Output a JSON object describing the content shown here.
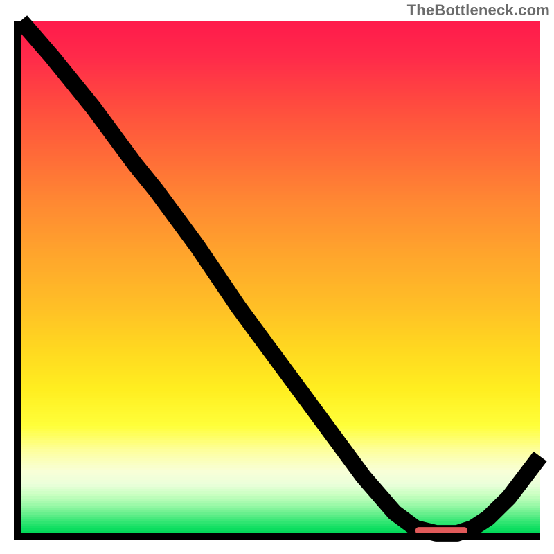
{
  "watermark": "TheBottleneck.com",
  "colors": {
    "axis": "#000000",
    "marker": "#e15a5a",
    "curve": "#000000"
  },
  "gradient_stops": [
    {
      "pct": 0.0,
      "color": "#ff1a4b"
    },
    {
      "pct": 0.07,
      "color": "#ff2a4a"
    },
    {
      "pct": 0.16,
      "color": "#ff4a3f"
    },
    {
      "pct": 0.26,
      "color": "#ff6a38"
    },
    {
      "pct": 0.36,
      "color": "#ff8a32"
    },
    {
      "pct": 0.46,
      "color": "#ffa62c"
    },
    {
      "pct": 0.56,
      "color": "#ffc026"
    },
    {
      "pct": 0.64,
      "color": "#ffd820"
    },
    {
      "pct": 0.72,
      "color": "#ffee20"
    },
    {
      "pct": 0.79,
      "color": "#ffff3a"
    },
    {
      "pct": 0.84,
      "color": "#fdffa0"
    },
    {
      "pct": 0.88,
      "color": "#f8ffd8"
    },
    {
      "pct": 0.905,
      "color": "#eaffda"
    },
    {
      "pct": 0.925,
      "color": "#c8ffc0"
    },
    {
      "pct": 0.945,
      "color": "#99f8a7"
    },
    {
      "pct": 0.962,
      "color": "#66ef8c"
    },
    {
      "pct": 0.978,
      "color": "#33e673"
    },
    {
      "pct": 0.99,
      "color": "#11df62"
    },
    {
      "pct": 1.0,
      "color": "#00d858"
    }
  ],
  "chart_data": {
    "type": "line",
    "title": "",
    "xlabel": "",
    "ylabel": "",
    "xlim": [
      0,
      100
    ],
    "ylim": [
      0,
      100
    ],
    "grid": false,
    "legend": false,
    "series": [
      {
        "name": "curve",
        "x": [
          0,
          6,
          14,
          22,
          26,
          34,
          42,
          50,
          58,
          66,
          72,
          76,
          80,
          84,
          87,
          90,
          94,
          100
        ],
        "y": [
          100,
          93,
          83,
          72,
          67,
          56,
          44,
          33,
          22,
          11,
          4,
          1,
          0,
          0,
          1,
          3,
          7,
          15
        ]
      }
    ],
    "highlight_segment": {
      "x_start": 76,
      "x_end": 86,
      "y": 0.5
    },
    "annotations": [
      {
        "text": "TheBottleneck.com",
        "pos": "top-right"
      }
    ]
  }
}
